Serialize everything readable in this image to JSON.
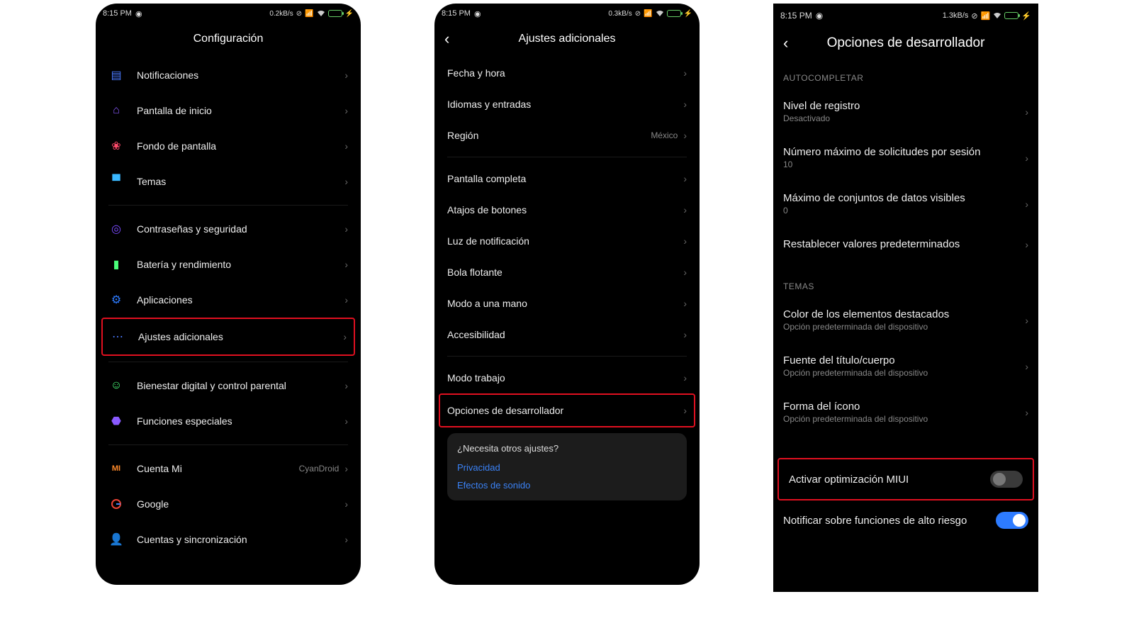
{
  "status": {
    "time": "8:15 PM",
    "rate1": "0.2kB/s",
    "rate2": "0.3kB/s",
    "rate3": "1.3kB/s"
  },
  "p1": {
    "title": "Configuración",
    "items": [
      {
        "label": "Notificaciones"
      },
      {
        "label": "Pantalla de inicio"
      },
      {
        "label": "Fondo de pantalla"
      },
      {
        "label": "Temas"
      },
      {
        "label": "Contraseñas y seguridad"
      },
      {
        "label": "Batería y rendimiento"
      },
      {
        "label": "Aplicaciones"
      },
      {
        "label": "Ajustes adicionales"
      },
      {
        "label": "Bienestar digital y control parental"
      },
      {
        "label": "Funciones especiales"
      },
      {
        "label": "Cuenta Mi",
        "value": "CyanDroid"
      },
      {
        "label": "Google"
      },
      {
        "label": "Cuentas y sincronización"
      }
    ]
  },
  "p2": {
    "title": "Ajustes adicionales",
    "items": [
      {
        "label": "Fecha y hora"
      },
      {
        "label": "Idiomas y entradas"
      },
      {
        "label": "Región",
        "value": "México"
      },
      {
        "label": "Pantalla completa"
      },
      {
        "label": "Atajos de botones"
      },
      {
        "label": "Luz de notificación"
      },
      {
        "label": "Bola flotante"
      },
      {
        "label": "Modo a una mano"
      },
      {
        "label": "Accesibilidad"
      },
      {
        "label": "Modo trabajo"
      },
      {
        "label": "Opciones de desarrollador"
      }
    ],
    "card": {
      "q": "¿Necesita otros ajustes?",
      "links": [
        "Privacidad",
        "Efectos de sonido"
      ]
    }
  },
  "p3": {
    "title": "Opciones de desarrollador",
    "sections": [
      {
        "header": "AUTOCOMPLETAR",
        "items": [
          {
            "main": "Nivel de registro",
            "sub": "Desactivado"
          },
          {
            "main": "Número máximo de solicitudes por sesión",
            "sub": "10"
          },
          {
            "main": "Máximo de conjuntos de datos visibles",
            "sub": "0"
          },
          {
            "main": "Restablecer valores predeterminados"
          }
        ]
      },
      {
        "header": "TEMAS",
        "items": [
          {
            "main": "Color de los elementos destacados",
            "sub": "Opción predeterminada del dispositivo"
          },
          {
            "main": "Fuente del título/cuerpo",
            "sub": "Opción predeterminada del dispositivo"
          },
          {
            "main": "Forma del ícono",
            "sub": "Opción predeterminada del dispositivo"
          }
        ]
      }
    ],
    "toggles": [
      {
        "label": "Activar optimización MIUI",
        "on": false
      },
      {
        "label": "Notificar sobre funciones de alto riesgo",
        "on": true
      }
    ]
  }
}
